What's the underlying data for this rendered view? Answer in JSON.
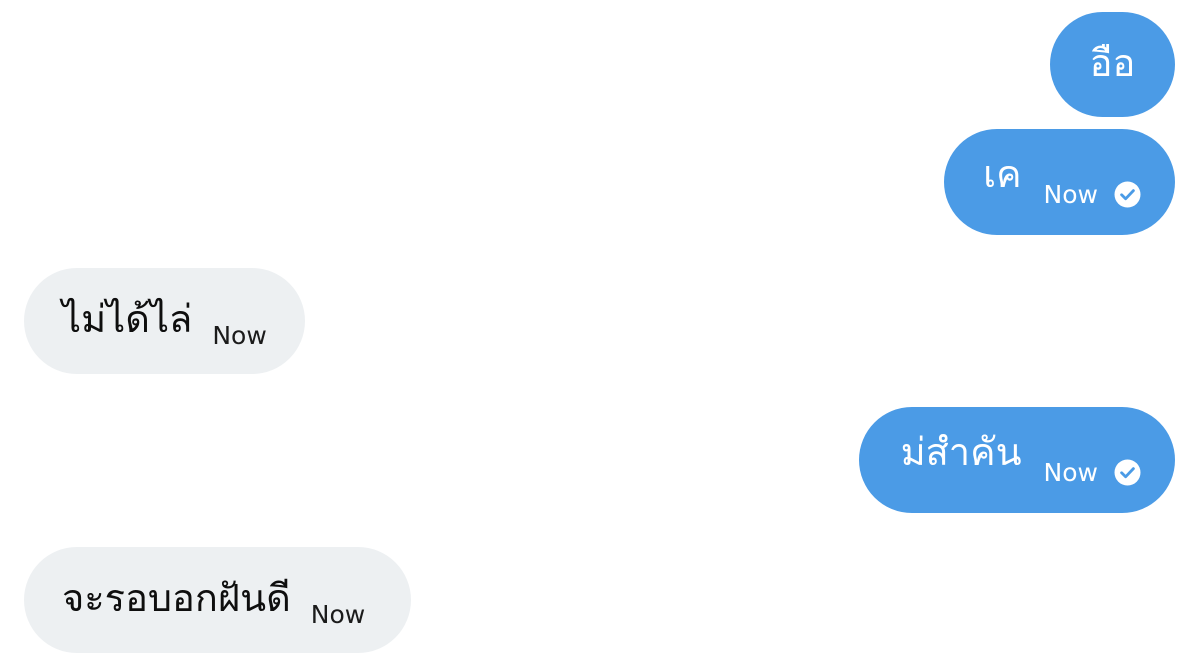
{
  "colors": {
    "sent_bubble": "#4b9be6",
    "received_bubble": "#edf0f2",
    "sent_text": "#ffffff",
    "received_text": "#0e0e0e"
  },
  "messages": [
    {
      "text": "อือ",
      "direction": "sent",
      "time": null,
      "status_icon": null
    },
    {
      "text": "เค",
      "direction": "sent",
      "time": "Now",
      "status_icon": "read-check-icon"
    },
    {
      "text": "ไม่ได้ไล่",
      "direction": "received",
      "time": "Now",
      "status_icon": null
    },
    {
      "text": "ม่สำคัน",
      "direction": "sent",
      "time": "Now",
      "status_icon": "read-check-icon"
    },
    {
      "text": "จะรอบอกฝันดี",
      "direction": "received",
      "time": "Now",
      "status_icon": null
    }
  ]
}
